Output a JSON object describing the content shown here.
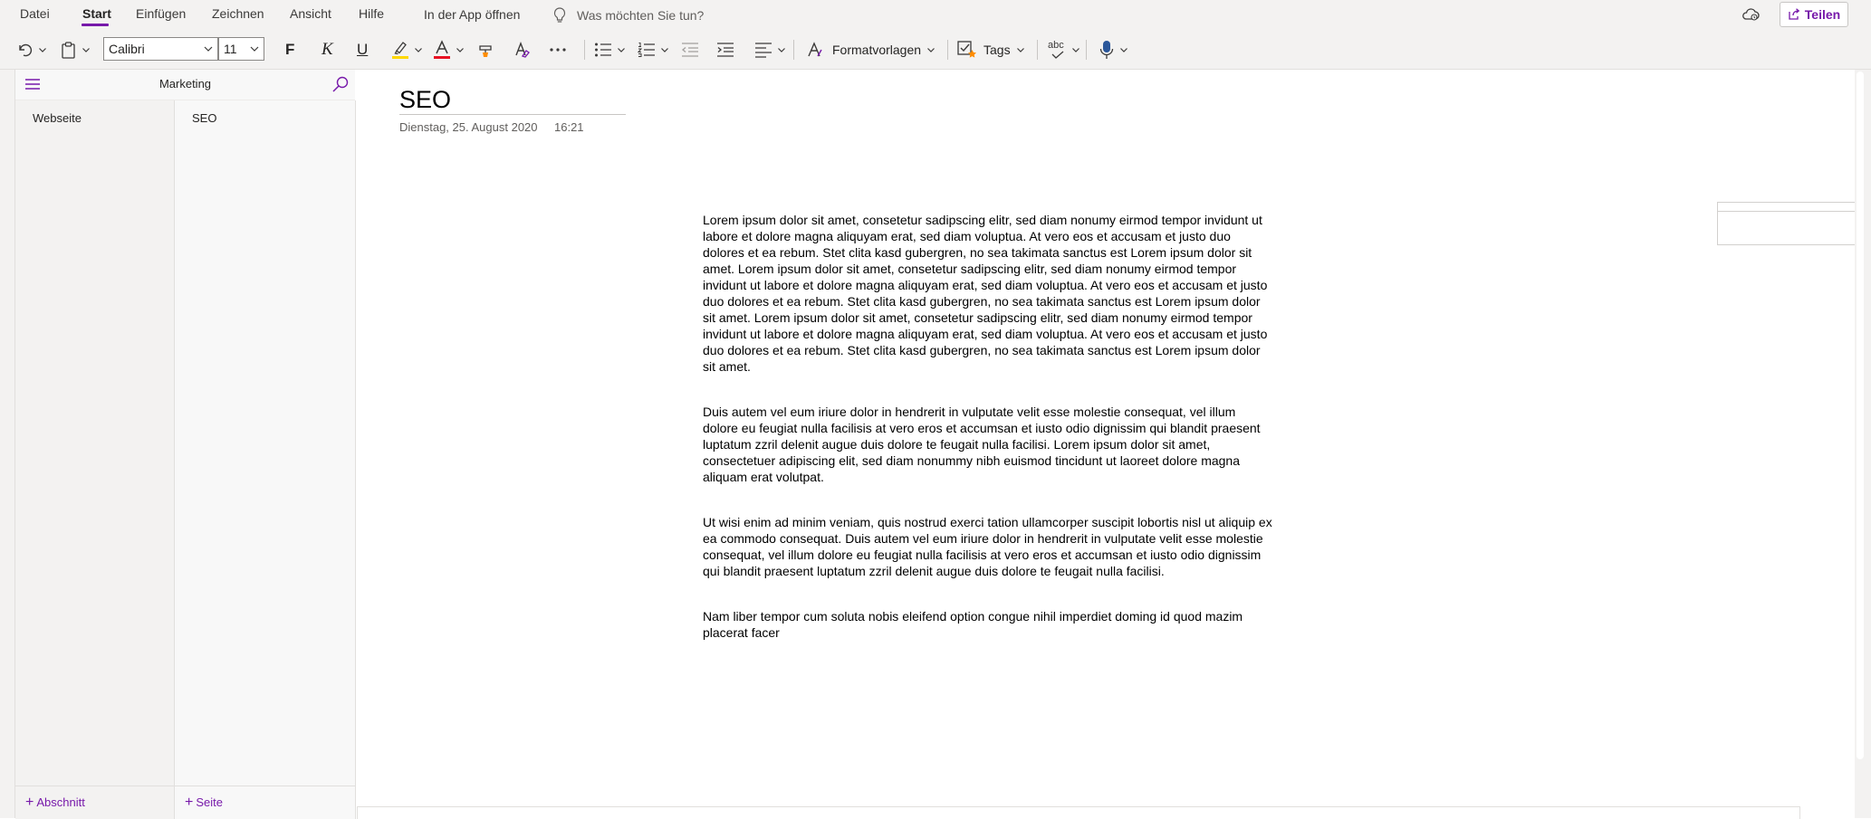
{
  "menu": {
    "items": [
      {
        "label": "Datei"
      },
      {
        "label": "Start"
      },
      {
        "label": "Einfügen"
      },
      {
        "label": "Zeichnen"
      },
      {
        "label": "Ansicht"
      },
      {
        "label": "Hilfe"
      }
    ],
    "active": "Start",
    "open_in_app": "In der App öffnen",
    "tell_me_placeholder": "Was möchten Sie tun?",
    "share_label": "Teilen"
  },
  "ribbon": {
    "font_name": "Calibri",
    "font_size": "11",
    "bold_label": "F",
    "italic_label": "K",
    "underline_label": "U",
    "styles_label": "Formatvorlagen",
    "tags_label": "Tags",
    "spelling_label": "abc",
    "colors": {
      "highlight": "#ffd800",
      "font_color": "#e81123",
      "accent": "#7719aa"
    }
  },
  "navigation": {
    "notebook_title": "Marketing",
    "sections": [
      {
        "label": "Webseite"
      }
    ],
    "pages": [
      {
        "label": "SEO"
      }
    ],
    "add_section_label": "Abschnitt",
    "add_page_label": "Seite"
  },
  "page": {
    "title": "SEO",
    "date": "Dienstag, 25. August 2020",
    "time": "16:21",
    "paragraphs": [
      "Lorem ipsum dolor sit amet, consetetur sadipscing elitr, sed diam nonumy eirmod tempor invidunt ut labore et dolore magna aliquyam erat, sed diam voluptua. At vero eos et accusam et justo duo dolores et ea rebum. Stet clita kasd gubergren, no sea takimata sanctus est Lorem ipsum dolor sit amet. Lorem ipsum dolor sit amet, consetetur sadipscing elitr, sed diam nonumy eirmod tempor invidunt ut labore et dolore magna aliquyam erat, sed diam voluptua. At vero eos et accusam et justo duo dolores et ea rebum. Stet clita kasd gubergren, no sea takimata sanctus est Lorem ipsum dolor sit amet. Lorem ipsum dolor sit amet, consetetur sadipscing elitr, sed diam nonumy eirmod tempor invidunt ut labore et dolore magna aliquyam erat, sed diam voluptua. At vero eos et accusam et justo duo dolores et ea rebum. Stet clita kasd gubergren, no sea takimata sanctus est Lorem ipsum dolor sit amet.",
      "Duis autem vel eum iriure dolor in hendrerit in vulputate velit esse molestie consequat, vel illum dolore eu feugiat nulla facilisis at vero eros et accumsan et iusto odio dignissim qui blandit praesent luptatum zzril delenit augue duis dolore te feugait nulla facilisi. Lorem ipsum dolor sit amet, consectetuer adipiscing elit, sed diam nonummy nibh euismod tincidunt ut laoreet dolore magna aliquam erat volutpat.",
      "Ut wisi enim ad minim veniam, quis nostrud exerci tation ullamcorper suscipit lobortis nisl ut aliquip ex ea commodo consequat. Duis autem vel eum iriure dolor in hendrerit in vulputate velit esse molestie consequat, vel illum dolore eu feugiat nulla facilisis at vero eros et accumsan et iusto odio dignissim qui blandit praesent luptatum zzril delenit augue duis dolore te feugait nulla facilisi.",
      "Nam liber tempor cum soluta nobis eleifend option congue nihil imperdiet doming id quod mazim placerat facer"
    ]
  }
}
